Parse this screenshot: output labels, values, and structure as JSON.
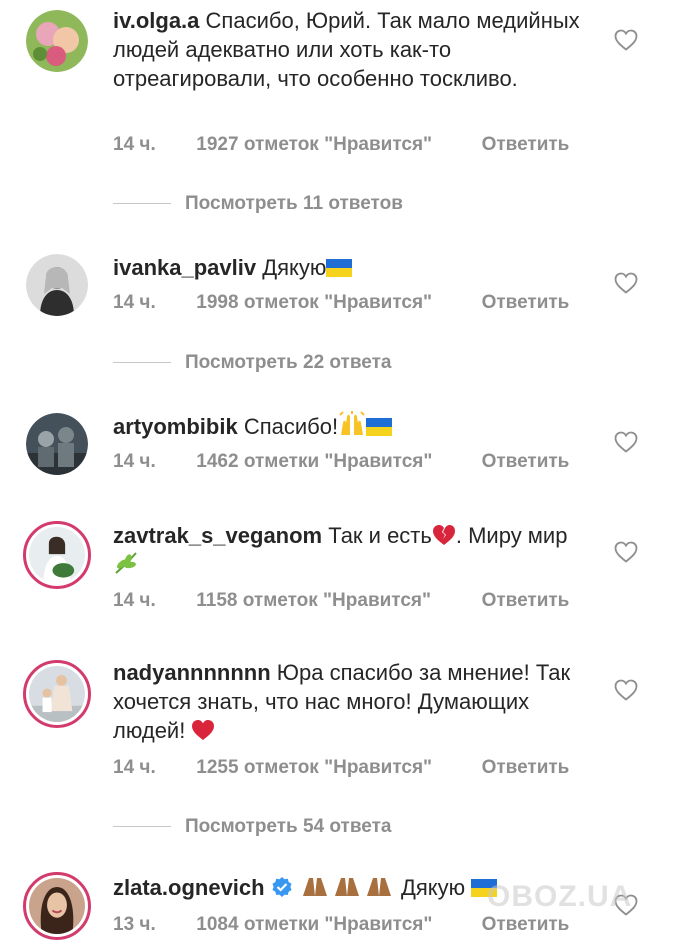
{
  "comments": [
    {
      "username": "iv.olga.a",
      "text": "Спасибо, Юрий. Так мало медийных людей адекватно или хоть как-то отреагировали, что особенно тоскливо.",
      "time": "14 ч.",
      "likes": "1927 отметок \"Нравится\"",
      "reply": "Ответить",
      "view_replies": "Посмотреть 11 ответов"
    },
    {
      "username": "ivanka_pavliv",
      "text": "Дякую",
      "time": "14 ч.",
      "likes": "1998 отметок \"Нравится\"",
      "reply": "Ответить",
      "view_replies": "Посмотреть 22 ответа"
    },
    {
      "username": "artyombibik",
      "text": "Спасибо!",
      "time": "14 ч.",
      "likes": "1462 отметки \"Нравится\"",
      "reply": "Ответить"
    },
    {
      "username": "zavtrak_s_veganom",
      "text_a": "Так и есть",
      "text_b": ". Миру мир",
      "time": "14 ч.",
      "likes": "1158 отметок \"Нравится\"",
      "reply": "Ответить"
    },
    {
      "username": "nadyannnnnnn",
      "text": "Юра спасибо за мнение! Так хочется знать, что нас много! Думающих людей!",
      "time": "14 ч.",
      "likes": "1255 отметок \"Нравится\"",
      "reply": "Ответить",
      "view_replies": "Посмотреть 54 ответа"
    },
    {
      "username": "zlata.ognevich",
      "text": "Дякую",
      "time": "13 ч.",
      "likes": "1084 отметки \"Нравится\"",
      "reply": "Ответить"
    }
  ],
  "watermark": "OBOZ.UA",
  "colors": {
    "text": "#262626",
    "muted": "#8e8e8e",
    "story_ring": "#d23b6c",
    "flag_blue": "#1e6ed6",
    "flag_yellow": "#f5d21b",
    "verified": "#3897f0"
  }
}
